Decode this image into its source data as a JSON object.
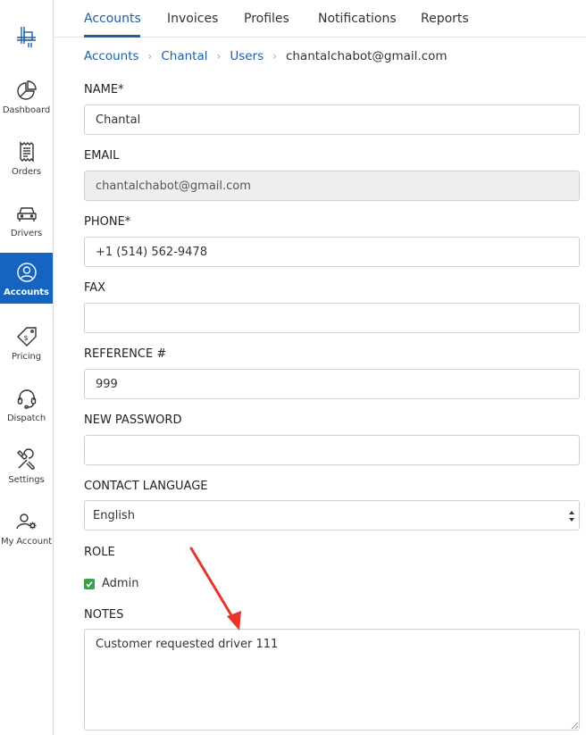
{
  "sidebar": {
    "logo_icon": "crosshair-logo-icon",
    "items": [
      {
        "label": "Dashboard",
        "icon": "pie-chart-icon"
      },
      {
        "label": "Orders",
        "icon": "receipt-icon"
      },
      {
        "label": "Drivers",
        "icon": "car-icon"
      },
      {
        "label": "Accounts",
        "icon": "user-circle-icon",
        "active": true
      },
      {
        "label": "Pricing",
        "icon": "price-tag-icon"
      },
      {
        "label": "Dispatch",
        "icon": "headset-icon"
      },
      {
        "label": "Settings",
        "icon": "tools-icon"
      },
      {
        "label": "My Account",
        "icon": "user-gear-icon"
      }
    ],
    "accent_color": "#ec5f86",
    "active_color": "#1565c0"
  },
  "tabs": [
    {
      "label": "Accounts",
      "active": true
    },
    {
      "label": "Invoices"
    },
    {
      "label": "Profiles"
    },
    {
      "label": "Notifications"
    },
    {
      "label": "Reports"
    }
  ],
  "breadcrumb": {
    "items": [
      "Accounts",
      "Chantal",
      "Users"
    ],
    "current": "chantalchabot@gmail.com"
  },
  "form": {
    "name": {
      "label": "NAME*",
      "value": "Chantal"
    },
    "email": {
      "label": "EMAIL",
      "value": "chantalchabot@gmail.com",
      "disabled": true
    },
    "phone": {
      "label": "PHONE*",
      "value": "+1 (514) 562-9478"
    },
    "fax": {
      "label": "FAX",
      "value": ""
    },
    "reference": {
      "label": "REFERENCE #",
      "value": "999"
    },
    "new_password": {
      "label": "NEW PASSWORD",
      "value": ""
    },
    "contact_language": {
      "label": "CONTACT LANGUAGE",
      "value": "English"
    },
    "role": {
      "label": "ROLE",
      "option": "Admin",
      "checked": true
    },
    "notes": {
      "label": "NOTES",
      "value": "Customer requested driver 111"
    }
  },
  "colors": {
    "link": "#1e5fa8",
    "checkbox": "#3aa04a",
    "annotation": "#e8362a"
  }
}
